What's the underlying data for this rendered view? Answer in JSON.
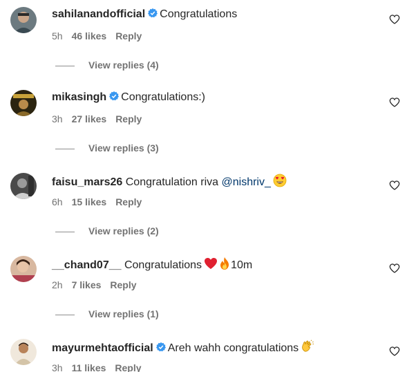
{
  "colors": {
    "verified": "#3897f0",
    "mention": "#00376b",
    "meta": "#737373"
  },
  "comments": [
    {
      "username": "sahilanandofficial",
      "verified": true,
      "text": "Congratulations",
      "time": "5h",
      "likes": "46 likes",
      "reply": "Reply",
      "view_replies": "View replies (4)"
    },
    {
      "username": "mikasingh",
      "verified": true,
      "text": "Congratulations:)",
      "time": "3h",
      "likes": "27 likes",
      "reply": "Reply",
      "view_replies": "View replies (3)"
    },
    {
      "username": "faisu_mars26",
      "verified": false,
      "text": "Congratulation riva",
      "mention": "@nishriv_",
      "emoji": "heart-eyes-emoji",
      "time": "6h",
      "likes": "15 likes",
      "reply": "Reply",
      "view_replies": "View replies (2)"
    },
    {
      "username": "__chand07__",
      "verified": false,
      "text": "Congratulations",
      "emoji": "red-heart-emoji fire-emoji",
      "text_after": "10m",
      "time": "2h",
      "likes": "7 likes",
      "reply": "Reply",
      "view_replies": "View replies (1)"
    },
    {
      "username": "mayurmehtaofficial",
      "verified": true,
      "text": "Areh wahh congratulations",
      "emoji": "clapping-hands-emoji",
      "time": "3h",
      "likes": "11 likes",
      "reply": "Reply"
    }
  ]
}
